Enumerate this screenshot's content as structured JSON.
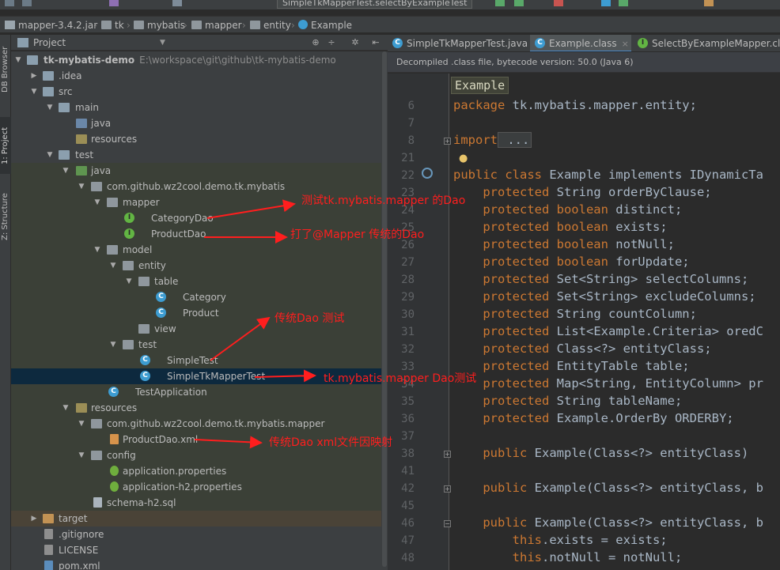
{
  "toolbar": {
    "run_config": "SimpleTkMapperTest.selectByExampleTest"
  },
  "navbar": {
    "crumbs": [
      "mapper-3.4.2.jar",
      "tk",
      "mybatis",
      "mapper",
      "entity",
      "Example"
    ]
  },
  "left_strip": {
    "tabs": [
      "DB Browser",
      "1: Project",
      "Z: Structure"
    ]
  },
  "project_panel": {
    "title": "Project",
    "tree": [
      {
        "label": "tk-mybatis-demo",
        "path": "E:\\workspace\\git\\github\\tk-mybatis-demo"
      },
      {
        "label": ".idea"
      },
      {
        "label": "src"
      },
      {
        "label": "main"
      },
      {
        "label": "java"
      },
      {
        "label": "resources"
      },
      {
        "label": "test"
      },
      {
        "label": "java"
      },
      {
        "label": "com.github.wz2cool.demo.tk.mybatis"
      },
      {
        "label": "mapper"
      },
      {
        "label": "CategoryDao"
      },
      {
        "label": "ProductDao"
      },
      {
        "label": "model"
      },
      {
        "label": "entity"
      },
      {
        "label": "table"
      },
      {
        "label": "Category"
      },
      {
        "label": "Product"
      },
      {
        "label": "view"
      },
      {
        "label": "test"
      },
      {
        "label": "SimpleTest"
      },
      {
        "label": "SimpleTkMapperTest"
      },
      {
        "label": "TestApplication"
      },
      {
        "label": "resources"
      },
      {
        "label": "com.github.wz2cool.demo.tk.mybatis.mapper"
      },
      {
        "label": "ProductDao.xml"
      },
      {
        "label": "config"
      },
      {
        "label": "application.properties"
      },
      {
        "label": "application-h2.properties"
      },
      {
        "label": "schema-h2.sql"
      },
      {
        "label": "target"
      },
      {
        "label": ".gitignore"
      },
      {
        "label": "LICENSE"
      },
      {
        "label": "pom.xml"
      }
    ]
  },
  "editor": {
    "tabs": [
      {
        "label": "SimpleTkMapperTest.java",
        "close": "×"
      },
      {
        "label": "Example.class",
        "close": "×"
      },
      {
        "label": "SelectByExampleMapper.class",
        "close": ""
      }
    ],
    "banner": "Decompiled .class file, bytecode version: 50.0 (Java 6)",
    "breadcrumb": "Example",
    "lines": [
      {
        "n": "6",
        "kw": "package",
        "rest": " tk.mybatis.mapper.entity;"
      },
      {
        "n": "7",
        "kw": "",
        "rest": ""
      },
      {
        "n": "8",
        "kw": "import",
        "rest": " ..."
      },
      {
        "n": "21",
        "kw": "",
        "rest": ""
      },
      {
        "n": "22",
        "kw": "public class",
        "rest": " Example implements IDynamicTa"
      },
      {
        "n": "23",
        "kw": "    protected",
        "rest": " String orderByClause;"
      },
      {
        "n": "24",
        "kw": "    protected boolean",
        "rest": " distinct;"
      },
      {
        "n": "25",
        "kw": "    protected boolean",
        "rest": " exists;"
      },
      {
        "n": "26",
        "kw": "    protected boolean",
        "rest": " notNull;"
      },
      {
        "n": "27",
        "kw": "    protected boolean",
        "rest": " forUpdate;"
      },
      {
        "n": "28",
        "kw": "    protected",
        "rest": " Set<String> selectColumns;"
      },
      {
        "n": "29",
        "kw": "    protected",
        "rest": " Set<String> excludeColumns;"
      },
      {
        "n": "30",
        "kw": "    protected",
        "rest": " String countColumn;"
      },
      {
        "n": "31",
        "kw": "    protected",
        "rest": " List<Example.Criteria> oredC"
      },
      {
        "n": "32",
        "kw": "    protected",
        "rest": " Class<?> entityClass;"
      },
      {
        "n": "33",
        "kw": "    protected",
        "rest": " EntityTable table;"
      },
      {
        "n": "34",
        "kw": "    protected",
        "rest": " Map<String, EntityColumn> pr"
      },
      {
        "n": "35",
        "kw": "    protected",
        "rest": " String tableName;"
      },
      {
        "n": "36",
        "kw": "    protected",
        "rest": " Example.OrderBy ORDERBY;"
      },
      {
        "n": "37",
        "kw": "",
        "rest": ""
      },
      {
        "n": "38",
        "kw": "    public",
        "rest": " Example(Class<?> entityClass) "
      },
      {
        "n": "41",
        "kw": "",
        "rest": ""
      },
      {
        "n": "42",
        "kw": "    public",
        "rest": " Example(Class<?> entityClass, b"
      },
      {
        "n": "45",
        "kw": "",
        "rest": ""
      },
      {
        "n": "46",
        "kw": "    public",
        "rest": " Example(Class<?> entityClass, b"
      },
      {
        "n": "47",
        "kw": "        this",
        "rest": ".exists = exists;"
      },
      {
        "n": "48",
        "kw": "        this",
        "rest": ".notNull = notNull;"
      }
    ]
  },
  "annotations": [
    "测试tk.mybatis.mapper 的Dao",
    "打了@Mapper 传统的Dao",
    "传统Dao 测试",
    "tk.mybatis.mapper Dao测试",
    "传统Dao xml文件因映射"
  ],
  "colors": {
    "annotation": "#ff1e1e",
    "keyword": "#cc7832",
    "selection": "#0d293e"
  }
}
